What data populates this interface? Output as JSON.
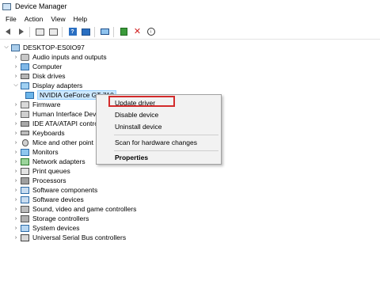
{
  "window": {
    "title": "Device Manager"
  },
  "menu": [
    "File",
    "Action",
    "View",
    "Help"
  ],
  "toolbar": {
    "icons": [
      "back-arrow-icon",
      "forward-arrow-icon",
      "properties-icon",
      "tree-view-icon",
      "help-icon",
      "view-icon",
      "monitor-icon",
      "add-driver-icon",
      "uninstall-icon",
      "download-icon"
    ]
  },
  "tree": {
    "root": "DESKTOP-ES0IO97",
    "items": [
      {
        "label": "Audio inputs and outputs",
        "icon": "speaker-icon"
      },
      {
        "label": "Computer",
        "icon": "computer-icon"
      },
      {
        "label": "Disk drives",
        "icon": "disk-drive-icon"
      },
      {
        "label": "Display adapters",
        "icon": "display-adapter-icon",
        "expanded": true
      },
      {
        "label": "NVIDIA GeForce GT 710",
        "icon": "gpu-icon",
        "child": true,
        "selected": true
      },
      {
        "label": "Firmware",
        "icon": "firmware-icon"
      },
      {
        "label": "Human Interface Dev",
        "icon": "hid-icon"
      },
      {
        "label": "IDE ATA/ATAPI contro",
        "icon": "ide-icon"
      },
      {
        "label": "Keyboards",
        "icon": "keyboard-icon"
      },
      {
        "label": "Mice and other point",
        "icon": "mouse-icon"
      },
      {
        "label": "Monitors",
        "icon": "monitor-icon"
      },
      {
        "label": "Network adapters",
        "icon": "network-icon"
      },
      {
        "label": "Print queues",
        "icon": "printer-icon"
      },
      {
        "label": "Processors",
        "icon": "processor-icon"
      },
      {
        "label": "Software components",
        "icon": "software-component-icon"
      },
      {
        "label": "Software devices",
        "icon": "software-device-icon"
      },
      {
        "label": "Sound, video and game controllers",
        "icon": "sound-icon"
      },
      {
        "label": "Storage controllers",
        "icon": "storage-icon"
      },
      {
        "label": "System devices",
        "icon": "system-icon"
      },
      {
        "label": "Universal Serial Bus controllers",
        "icon": "usb-icon"
      }
    ]
  },
  "context_menu": {
    "update_driver": "Update driver",
    "disable_device": "Disable device",
    "uninstall_device": "Uninstall device",
    "scan_hardware": "Scan for hardware changes",
    "properties": "Properties"
  },
  "colors": {
    "highlight_border": "#d32b2b",
    "selection_bg": "#cce8ff"
  }
}
